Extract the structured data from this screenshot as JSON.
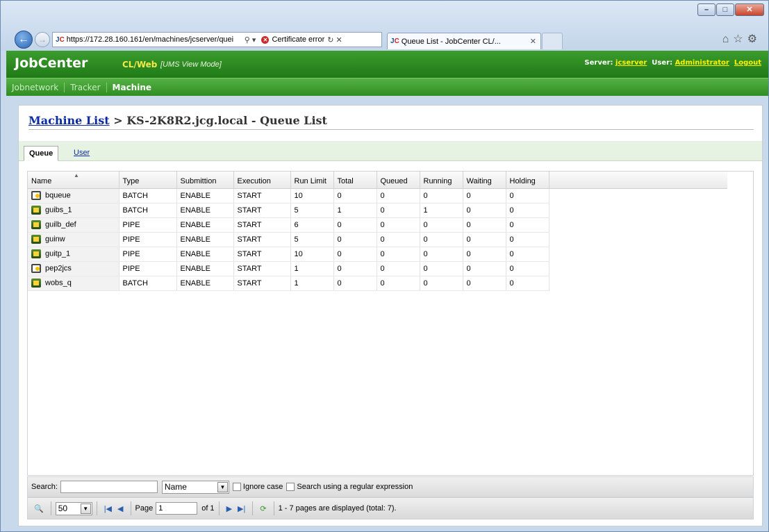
{
  "browser": {
    "address_url": "https://172.28.160.161/en/machines/jcserver/quei",
    "cert_error": "Certificate error",
    "tab_title": "Queue List - JobCenter CL/...",
    "logo_j": "J",
    "logo_c": "C"
  },
  "app": {
    "brand": "JobCenter",
    "brand_sub": "CL/Web",
    "mode": "[UMS View Mode]",
    "server_label": "Server:",
    "server": "jcserver",
    "user_label": "User:",
    "user": "Administrator",
    "logout": "Logout"
  },
  "menu": {
    "jobnetwork": "Jobnetwork",
    "tracker": "Tracker",
    "machine": "Machine"
  },
  "page": {
    "crumb_link": "Machine List",
    "crumb_sep": ">",
    "title": "KS-2K8R2.jcg.local - Queue List"
  },
  "tabs": {
    "queue": "Queue",
    "user": "User"
  },
  "grid": {
    "headers": [
      "Name",
      "Type",
      "Submittion",
      "Execution",
      "Run Limit",
      "Total",
      "Queued",
      "Running",
      "Waiting",
      "Holding"
    ],
    "rows": [
      {
        "icon": "batch",
        "name": "bqueue",
        "type": "BATCH",
        "sub": "ENABLE",
        "exec": "START",
        "limit": "10",
        "total": "0",
        "queued": "0",
        "running": "0",
        "waiting": "0",
        "holding": "0"
      },
      {
        "icon": "pipe",
        "name": "guibs_1",
        "type": "BATCH",
        "sub": "ENABLE",
        "exec": "START",
        "limit": "5",
        "total": "1",
        "queued": "0",
        "running": "1",
        "waiting": "0",
        "holding": "0"
      },
      {
        "icon": "pipe",
        "name": "guilb_def",
        "type": "PIPE",
        "sub": "ENABLE",
        "exec": "START",
        "limit": "6",
        "total": "0",
        "queued": "0",
        "running": "0",
        "waiting": "0",
        "holding": "0"
      },
      {
        "icon": "pipe",
        "name": "guinw",
        "type": "PIPE",
        "sub": "ENABLE",
        "exec": "START",
        "limit": "5",
        "total": "0",
        "queued": "0",
        "running": "0",
        "waiting": "0",
        "holding": "0"
      },
      {
        "icon": "pipe",
        "name": "guitp_1",
        "type": "PIPE",
        "sub": "ENABLE",
        "exec": "START",
        "limit": "10",
        "total": "0",
        "queued": "0",
        "running": "0",
        "waiting": "0",
        "holding": "0"
      },
      {
        "icon": "batch",
        "name": "pep2jcs",
        "type": "PIPE",
        "sub": "ENABLE",
        "exec": "START",
        "limit": "1",
        "total": "0",
        "queued": "0",
        "running": "0",
        "waiting": "0",
        "holding": "0"
      },
      {
        "icon": "pipe",
        "name": "wobs_q",
        "type": "BATCH",
        "sub": "ENABLE",
        "exec": "START",
        "limit": "1",
        "total": "0",
        "queued": "0",
        "running": "0",
        "waiting": "0",
        "holding": "0"
      }
    ]
  },
  "search": {
    "label": "Search:",
    "value": "",
    "field": "Name",
    "ignore_case": "Ignore case",
    "regex": "Search using a regular expression"
  },
  "pager": {
    "page_size": "50",
    "page_label": "Page",
    "page_value": "1",
    "of_label": "of 1",
    "status": "1 - 7 pages are displayed (total: 7)."
  },
  "colors": {
    "header_green": "#1f7a16",
    "link_blue": "#0b2ba6",
    "server_yellow": "#fff200"
  }
}
